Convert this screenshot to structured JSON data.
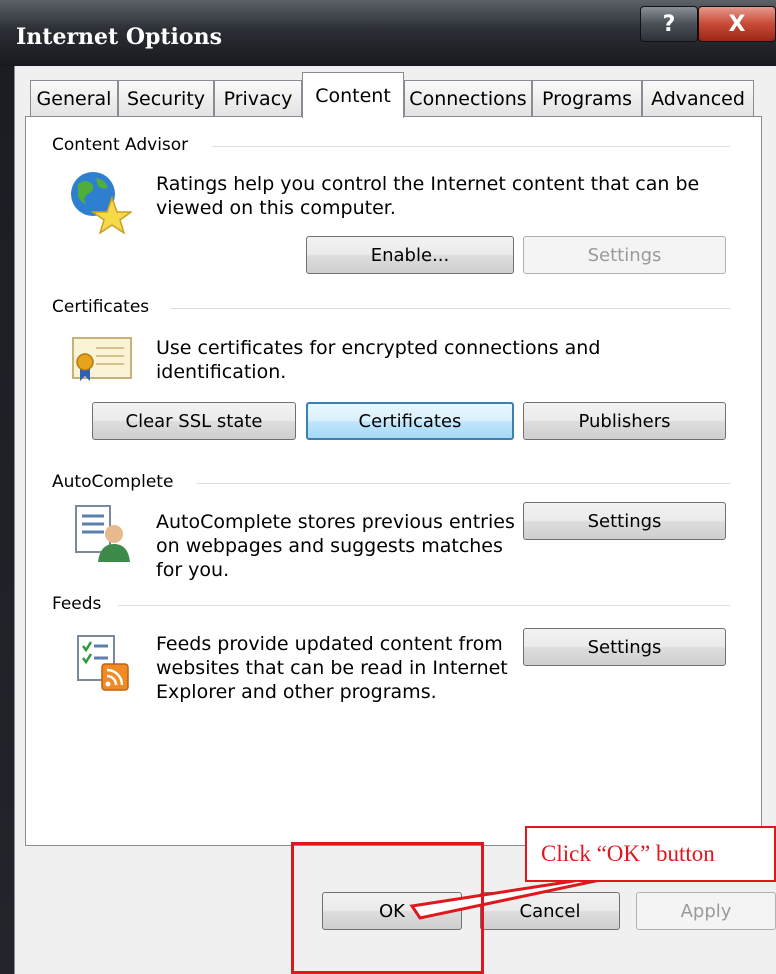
{
  "window": {
    "title": "Internet Options",
    "help_label": "?",
    "close_label": "X"
  },
  "tabs": [
    {
      "label": "General"
    },
    {
      "label": "Security"
    },
    {
      "label": "Privacy"
    },
    {
      "label": "Content",
      "active": true
    },
    {
      "label": "Connections"
    },
    {
      "label": "Programs"
    },
    {
      "label": "Advanced"
    }
  ],
  "content_advisor": {
    "title": "Content Advisor",
    "description": "Ratings help you control the Internet content that can be viewed on this computer.",
    "enable_label": "Enable...",
    "settings_label": "Settings",
    "icon": "globe-star-icon"
  },
  "certificates": {
    "title": "Certificates",
    "description": "Use certificates for encrypted connections and identification.",
    "clear_ssl_label": "Clear SSL state",
    "certificates_label": "Certificates",
    "publishers_label": "Publishers",
    "icon": "certificate-icon"
  },
  "autocomplete": {
    "title": "AutoComplete",
    "description": "AutoComplete stores previous entries on webpages and suggests matches for you.",
    "settings_label": "Settings",
    "icon": "form-user-icon"
  },
  "feeds": {
    "title": "Feeds",
    "description": "Feeds provide updated content from websites that can be read in Internet Explorer and other programs.",
    "settings_label": "Settings",
    "icon": "rss-feed-icon"
  },
  "footer": {
    "ok_label": "OK",
    "cancel_label": "Cancel",
    "apply_label": "Apply"
  },
  "annotation": {
    "callout_text": "Click “OK” button",
    "color": "#e0171c"
  }
}
